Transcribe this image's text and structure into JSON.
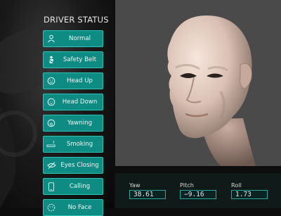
{
  "panel": {
    "title": "DRIVER STATUS",
    "items": [
      {
        "label": "Normal",
        "icon": "person-icon"
      },
      {
        "label": "Safety Belt",
        "icon": "seatbelt-icon"
      },
      {
        "label": "Head Up",
        "icon": "face-icon"
      },
      {
        "label": "Head Down",
        "icon": "face-down-icon"
      },
      {
        "label": "Yawning",
        "icon": "yawn-icon"
      },
      {
        "label": "Smoking",
        "icon": "cigarette-icon"
      },
      {
        "label": "Eyes Closing",
        "icon": "eye-closed-icon"
      },
      {
        "label": "Calling",
        "icon": "phone-icon"
      },
      {
        "label": "No Face",
        "icon": "no-face-icon"
      }
    ]
  },
  "readouts": {
    "yaw": {
      "label": "Yaw",
      "value": "38.61"
    },
    "pitch": {
      "label": "Pitch",
      "value": "−9.16"
    },
    "roll": {
      "label": "Roll",
      "value": "1.73"
    }
  },
  "colors": {
    "button_fill": "#0e8c84",
    "button_border": "#2fc2b6",
    "viewport_bg": "#4a4a4a"
  }
}
